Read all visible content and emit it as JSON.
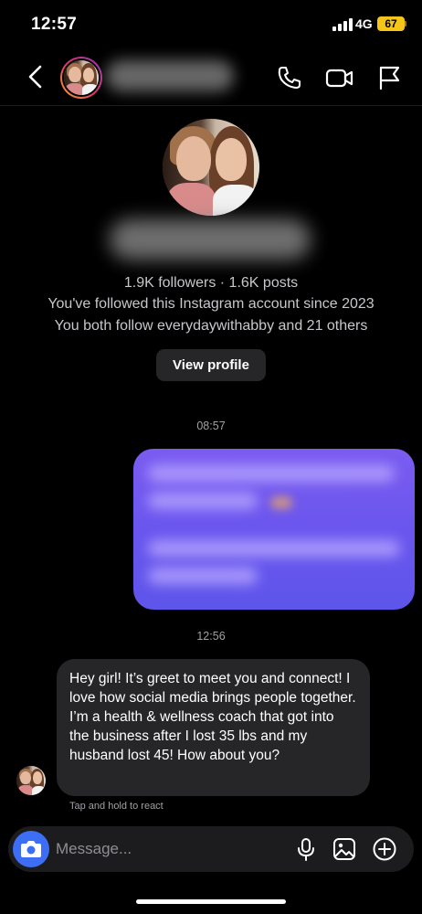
{
  "status_bar": {
    "time": "12:57",
    "network": "4G",
    "battery": "67"
  },
  "header": {
    "icons": [
      "back-icon",
      "phone-icon",
      "video-icon",
      "flag-icon"
    ]
  },
  "profile": {
    "stats": "1.9K followers · 1.6K posts",
    "followed_since": "You've followed this Instagram account since 2023",
    "mutual": "You both follow everydaywithabby and 21 others",
    "view_profile_label": "View profile"
  },
  "thread": {
    "timestamp_1": "08:57",
    "timestamp_2": "12:56",
    "received_message": "Hey girl! It’s greet to meet you and connect! I love how social media brings people together. I’m a health & wellness coach that got into the business after I lost 35 lbs and my husband lost 45! How about you?",
    "react_hint": "Tap and hold to react"
  },
  "composer": {
    "placeholder": "Message...",
    "icons": [
      "camera-icon",
      "microphone-icon",
      "gallery-icon",
      "plus-icon"
    ]
  },
  "colors": {
    "accent_blue": "#3d6ef6",
    "sent_bubble": "#6a56ee",
    "battery": "#f5c518"
  }
}
